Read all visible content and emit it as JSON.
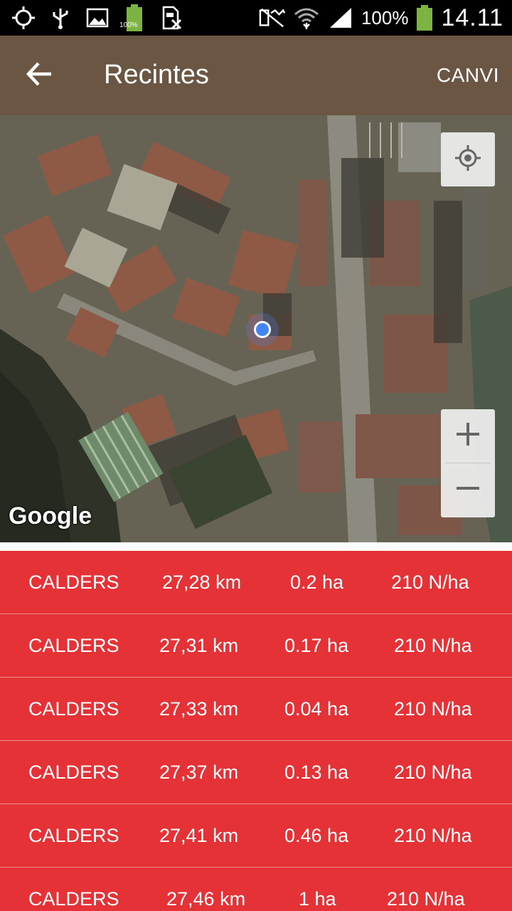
{
  "status_bar": {
    "battery_percent_label": "100%",
    "battery_small_label": "100%",
    "time": "14.11",
    "icons": [
      "gps-icon",
      "usb-icon",
      "image-icon",
      "battery-full-icon",
      "sim-off-icon",
      "mute-icon",
      "wifi-icon",
      "signal-icon",
      "battery-icon"
    ]
  },
  "toolbar": {
    "title": "Recintes",
    "action_label": "CANVI",
    "color": "#6b5644"
  },
  "map": {
    "provider_label": "Google",
    "zoom_in_label": "+",
    "zoom_out_label": "−"
  },
  "list": {
    "color": "#e53237",
    "rows": [
      {
        "name": "CALDERS",
        "distance": "27,28 km",
        "area": "0.2 ha",
        "nitrogen": "210 N/ha"
      },
      {
        "name": "CALDERS",
        "distance": "27,31 km",
        "area": "0.17 ha",
        "nitrogen": "210 N/ha"
      },
      {
        "name": "CALDERS",
        "distance": "27,33 km",
        "area": "0.04 ha",
        "nitrogen": "210 N/ha"
      },
      {
        "name": "CALDERS",
        "distance": "27,37 km",
        "area": "0.13 ha",
        "nitrogen": "210 N/ha"
      },
      {
        "name": "CALDERS",
        "distance": "27,41 km",
        "area": "0.46 ha",
        "nitrogen": "210 N/ha"
      },
      {
        "name": "CALDERS",
        "distance": "27,46 km",
        "area": "1 ha",
        "nitrogen": "210 N/ha"
      }
    ]
  }
}
